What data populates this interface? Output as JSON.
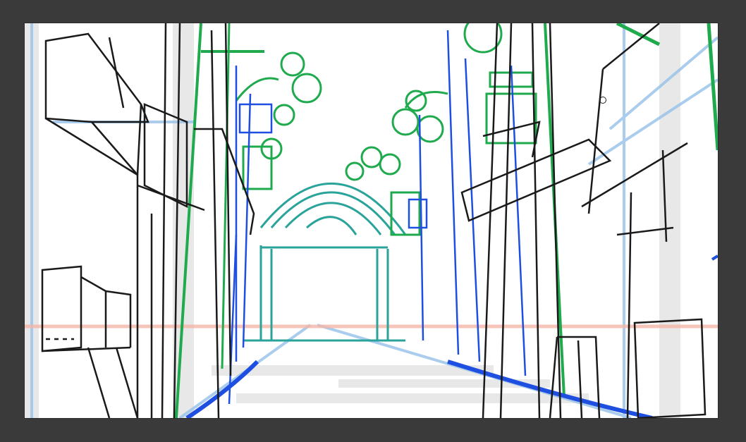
{
  "app": {
    "canvas_background": "#ffffff",
    "workspace_background": "#3a3a3a"
  },
  "sketch": {
    "subject": "",
    "layers": [
      {
        "name": "",
        "color": "#1a1a1a"
      },
      {
        "name": "",
        "color": "#1faa4d"
      },
      {
        "name": "",
        "color": "#1f4fe0"
      },
      {
        "name": "",
        "color": "#2aa39a"
      },
      {
        "name": "",
        "color": "#9cc4ea"
      },
      {
        "name": "",
        "color": "#f4b6a8"
      }
    ]
  },
  "cursor": {
    "icon": "brush-cursor-icon"
  }
}
